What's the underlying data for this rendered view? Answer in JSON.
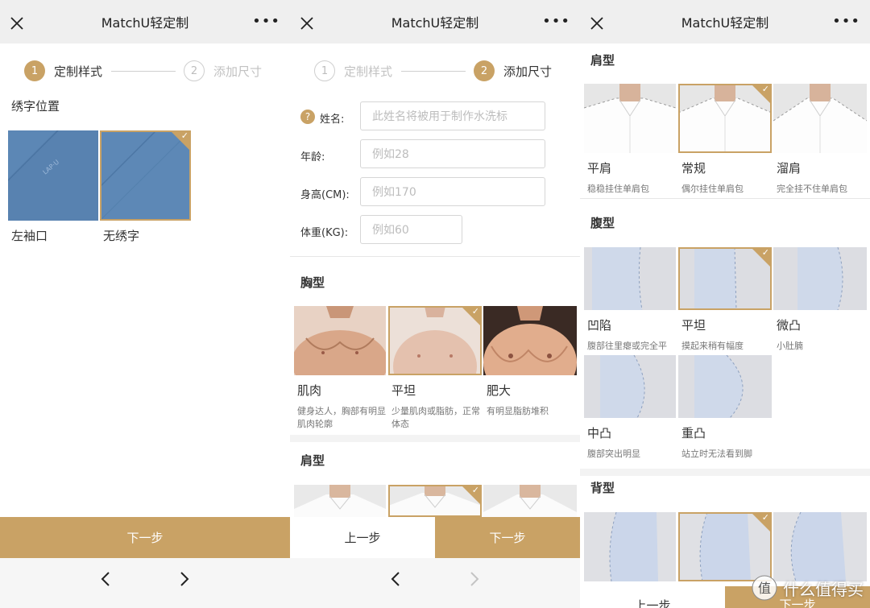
{
  "app_title": "MatchU轻定制",
  "colors": {
    "accent": "#c9a265",
    "topbar": "#efefef",
    "navbar": "#f6f6f6"
  },
  "panel1": {
    "step1": {
      "num": "1",
      "label": "定制样式"
    },
    "step2": {
      "num": "2",
      "label": "添加尺寸"
    },
    "section": "绣字位置",
    "options": [
      {
        "name": "左袖口",
        "embroidery": "LAP·U",
        "selected": false
      },
      {
        "name": "无绣字",
        "selected": true
      }
    ],
    "next_label": "下一步"
  },
  "panel2": {
    "step1": {
      "num": "1",
      "label": "定制样式"
    },
    "step2": {
      "num": "2",
      "label": "添加尺寸"
    },
    "help_icon": "?",
    "fields": [
      {
        "label": "姓名:",
        "placeholder": "此姓名将被用于制作水洗标"
      },
      {
        "label": "年龄:",
        "placeholder": "例如28"
      },
      {
        "label": "身高(CM):",
        "placeholder": "例如170"
      },
      {
        "label": "体重(KG):",
        "placeholder": "例如60"
      }
    ],
    "chest_title": "胸型",
    "chest_options": [
      {
        "name": "肌肉",
        "desc": "健身达人，胸部有明显肌肉轮廓",
        "selected": false
      },
      {
        "name": "平坦",
        "desc": "少量肌肉或脂肪，正常体态",
        "selected": true
      },
      {
        "name": "肥大",
        "desc": "有明显脂肪堆积",
        "selected": false
      }
    ],
    "shoulder_title": "肩型",
    "prev_label": "上一步",
    "next_label": "下一步"
  },
  "panel3": {
    "shoulder_title": "肩型",
    "shoulder_options": [
      {
        "name": "平肩",
        "desc": "稳稳挂住单肩包",
        "selected": false
      },
      {
        "name": "常规",
        "desc": "偶尔挂住单肩包",
        "selected": true
      },
      {
        "name": "溜肩",
        "desc": "完全挂不住单肩包",
        "selected": false
      }
    ],
    "belly_title": "腹型",
    "belly_options": [
      {
        "name": "凹陷",
        "desc": "腹部往里瘪或完全平",
        "selected": false
      },
      {
        "name": "平坦",
        "desc": "摸起来稍有幅度",
        "selected": true
      },
      {
        "name": "微凸",
        "desc": "小肚腩",
        "selected": false
      },
      {
        "name": "中凸",
        "desc": "腹部突出明显",
        "selected": false
      },
      {
        "name": "重凸",
        "desc": "站立时无法看到脚",
        "selected": false
      }
    ],
    "back_title": "背型",
    "prev_label": "上一步",
    "next_label": "下一步",
    "watermark": "什么值得买",
    "watermark_logo": "值"
  },
  "icons": {
    "close": "close-icon",
    "more": "more-icon",
    "back": "chevron-left-icon",
    "forward": "chevron-right-icon",
    "check": "check-icon",
    "help": "help-icon"
  }
}
